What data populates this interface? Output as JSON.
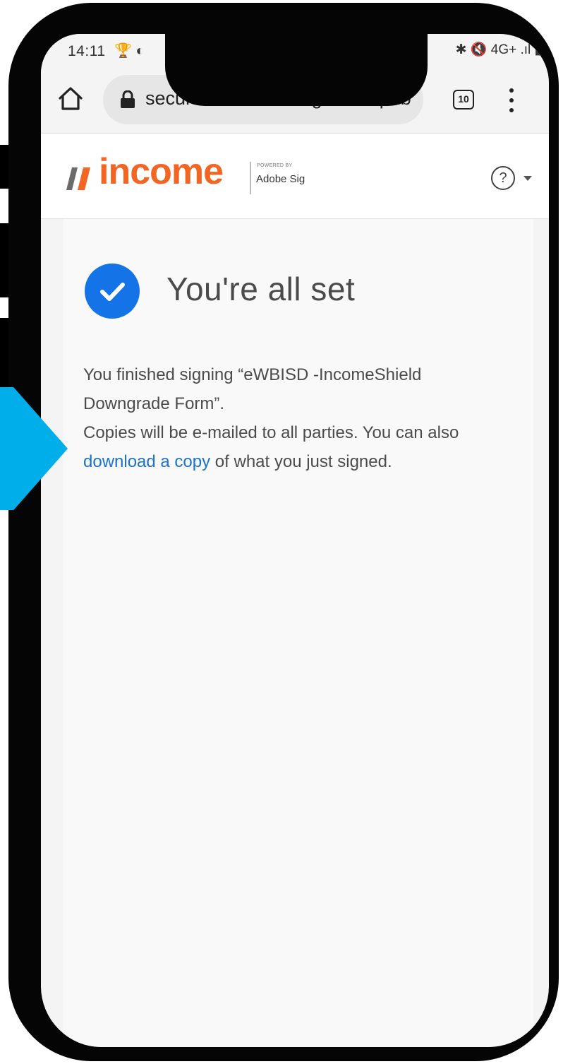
{
  "status_bar": {
    "time": "14:11",
    "left_icons": "🏆 ◐",
    "right_icons": "✱ 🔇 4G+ .ıl ▮"
  },
  "browser": {
    "url": "secure.eu1.adobesign.com/pub",
    "tab_count": "10"
  },
  "header": {
    "logo_text": "income",
    "powered_by": "POWERED BY",
    "adobe_sign": "Adobe Sig",
    "help_symbol": "?"
  },
  "confirmation": {
    "headline": "You're all set",
    "line1": "You finished signing “eWBISD -IncomeShield Downgrade Form”.",
    "line2_prefix": "Copies will be e-mailed to all parties. You can also ",
    "download_link": "download a copy",
    "line2_suffix": " of what you just signed."
  },
  "colors": {
    "brand_orange": "#f26522",
    "check_blue": "#1473e6",
    "link_blue": "#1a73c9",
    "arrow_blue": "#00aee9"
  }
}
